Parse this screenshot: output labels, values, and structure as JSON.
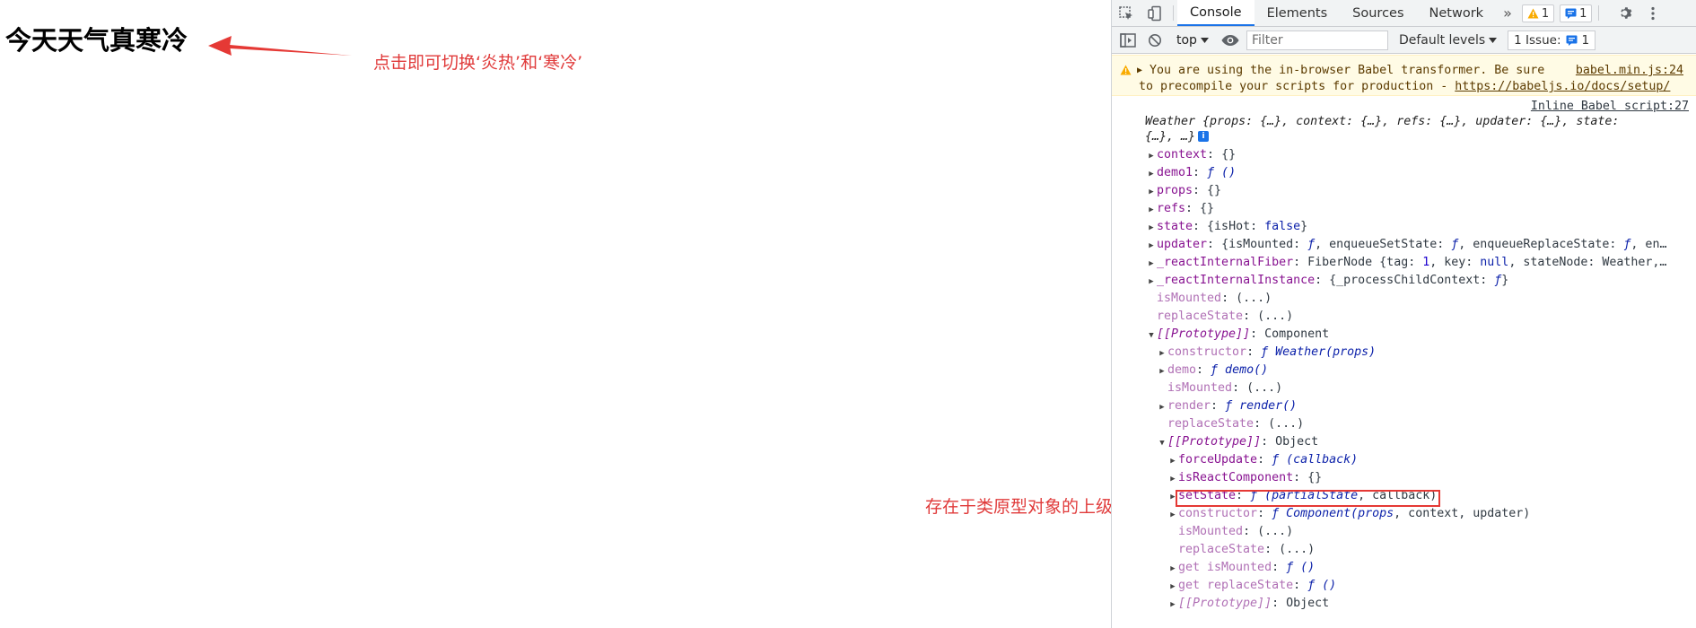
{
  "page": {
    "title": "今天天气真寒冷",
    "annotation_toggle": "点击即可切换‘炎热’和‘寒冷’",
    "annotation_proto": "存在于类原型对象的上级对象",
    "annotation_color": "#e03a3a"
  },
  "devtools": {
    "tabs": [
      "Console",
      "Elements",
      "Sources",
      "Network"
    ],
    "active_tab": "Console",
    "more_tabs": "»",
    "warning_count": "1",
    "message_count": "1",
    "toolbar": {
      "context": "top",
      "filter_placeholder": "Filter",
      "levels": "Default levels",
      "issues_label": "1 Issue:",
      "issues_count": "1"
    },
    "warning": {
      "line1": "You are using the in-browser Babel transformer. Be sure",
      "line2": "to precompile your scripts for production - ",
      "link": "https://babeljs.io/docs/setup/",
      "source": "babel.min.js:24"
    },
    "log_source": "Inline Babel script:27",
    "header_line1": "Weather {props: {…}, context: {…}, refs: {…}, updater: {…}, state:",
    "header_line2": "{…}, …}",
    "rows": [
      {
        "indent": 1,
        "arrow": "▶",
        "key": "context",
        "sep": ": ",
        "val": "{}"
      },
      {
        "indent": 1,
        "arrow": "▶",
        "key": "demo1",
        "sep": ": ",
        "val": "ƒ ()"
      },
      {
        "indent": 1,
        "arrow": "▶",
        "key": "props",
        "sep": ": ",
        "val": "{}"
      },
      {
        "indent": 1,
        "arrow": "▶",
        "key": "refs",
        "sep": ": ",
        "val": "{}"
      },
      {
        "indent": 1,
        "arrow": "▶",
        "key": "state",
        "sep": ": ",
        "val": "{isHot: false}"
      },
      {
        "indent": 1,
        "arrow": "▶",
        "key": "updater",
        "sep": ": ",
        "val": "{isMounted: ƒ, enqueueSetState: ƒ, enqueueReplaceState: ƒ, en…"
      },
      {
        "indent": 1,
        "arrow": "▶",
        "key": "_reactInternalFiber",
        "sep": ": ",
        "val": "FiberNode {tag: 1, key: null, stateNode: Weather,…"
      },
      {
        "indent": 1,
        "arrow": "▶",
        "key": "_reactInternalInstance",
        "sep": ": ",
        "val": "{_processChildContext: ƒ}"
      },
      {
        "indent": 1,
        "arrow": "",
        "key": "isMounted",
        "sep": ": ",
        "val": "(...)",
        "dim": true
      },
      {
        "indent": 1,
        "arrow": "",
        "key": "replaceState",
        "sep": ": ",
        "val": "(...)",
        "dim": true
      },
      {
        "indent": 1,
        "arrow": "▼",
        "key": "[[Prototype]]",
        "sep": ": ",
        "val": "Component"
      },
      {
        "indent": 2,
        "arrow": "▶",
        "key": "constructor",
        "sep": ": ",
        "val": "ƒ Weather(props)",
        "dim": true
      },
      {
        "indent": 2,
        "arrow": "▶",
        "key": "demo",
        "sep": ": ",
        "val": "ƒ demo()",
        "dim": true
      },
      {
        "indent": 2,
        "arrow": "",
        "key": "isMounted",
        "sep": ": ",
        "val": "(...)",
        "dim": true
      },
      {
        "indent": 2,
        "arrow": "▶",
        "key": "render",
        "sep": ": ",
        "val": "ƒ render()",
        "dim": true
      },
      {
        "indent": 2,
        "arrow": "",
        "key": "replaceState",
        "sep": ": ",
        "val": "(...)",
        "dim": true
      },
      {
        "indent": 2,
        "arrow": "▼",
        "key": "[[Prototype]]",
        "sep": ": ",
        "val": "Object"
      },
      {
        "indent": 3,
        "arrow": "▶",
        "key": "forceUpdate",
        "sep": ": ",
        "val": "ƒ (callback)"
      },
      {
        "indent": 3,
        "arrow": "▶",
        "key": "isReactComponent",
        "sep": ": ",
        "val": "{}"
      },
      {
        "indent": 3,
        "arrow": "▶",
        "key": "setState",
        "sep": ": ",
        "val": "ƒ (partialState, callback)",
        "highlight": true
      },
      {
        "indent": 3,
        "arrow": "▶",
        "key": "constructor",
        "sep": ": ",
        "val": "ƒ Component(props, context, updater)",
        "dim": true
      },
      {
        "indent": 3,
        "arrow": "",
        "key": "isMounted",
        "sep": ": ",
        "val": "(...)",
        "dim": true
      },
      {
        "indent": 3,
        "arrow": "",
        "key": "replaceState",
        "sep": ": ",
        "val": "(...)",
        "dim": true
      },
      {
        "indent": 3,
        "arrow": "▶",
        "key": "get isMounted",
        "sep": ": ",
        "val": "ƒ ()",
        "dim": true
      },
      {
        "indent": 3,
        "arrow": "▶",
        "key": "get replaceState",
        "sep": ": ",
        "val": "ƒ ()",
        "dim": true
      },
      {
        "indent": 3,
        "arrow": "▶",
        "key": "[[Prototype]]",
        "sep": ": ",
        "val": "Object",
        "dim": true
      }
    ],
    "prompt": "›"
  }
}
